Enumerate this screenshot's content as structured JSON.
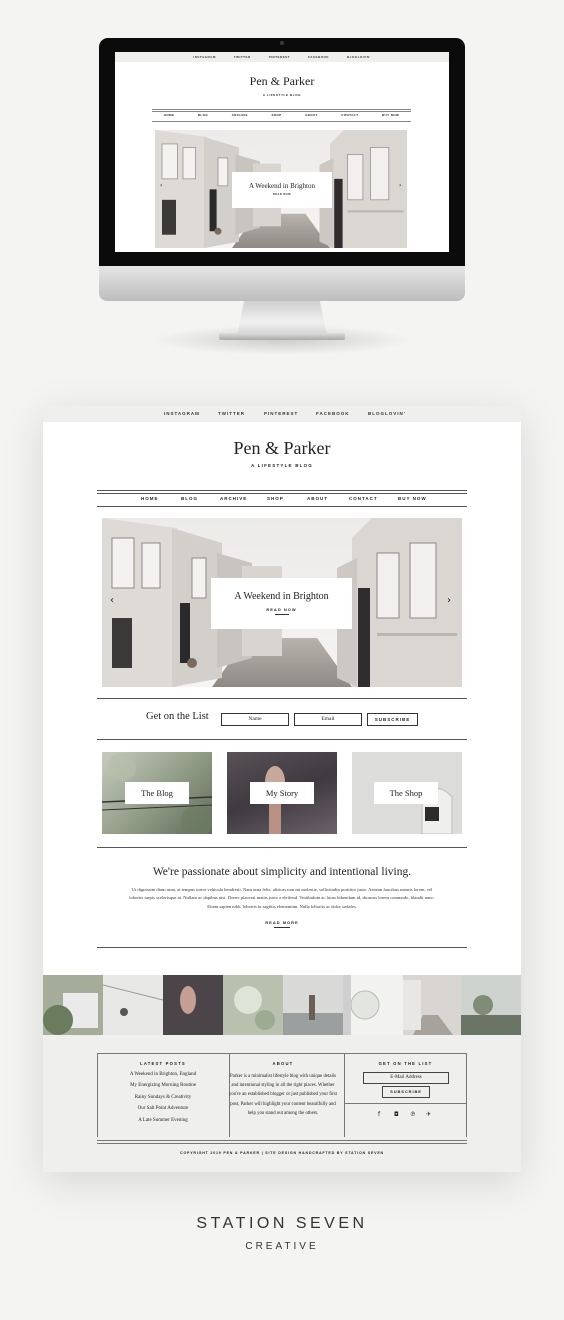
{
  "colors": {
    "background": "#f4f4f3",
    "topbar": "#efefee",
    "text": "#222222",
    "footer": "#efefee"
  },
  "social_links": [
    "INSTAGRAM",
    "TWITTER",
    "PINTEREST",
    "FACEBOOK",
    "BLOGLOVIN'"
  ],
  "site": {
    "title": "Pen & Parker",
    "tagline": "A LIFESTYLE BLOG"
  },
  "nav": [
    "HOME",
    "BLOG",
    "ARCHIVE",
    "SHOP",
    "ABOUT",
    "CONTACT",
    "BUY NOW"
  ],
  "hero": {
    "title": "A Weekend in Brighton",
    "cta": "READ NOW",
    "prev_icon": "chevron-left-icon",
    "next_icon": "chevron-right-icon"
  },
  "signup": {
    "label": "Get on the List",
    "name_placeholder": "Name",
    "email_placeholder": "Email",
    "button": "SUBSCRIBE"
  },
  "tiles": [
    "The Blog",
    "My Story",
    "The Shop"
  ],
  "intro": {
    "heading": "We're passionate about simplicity and intentional living.",
    "body": "Ut dignissim diam urna, at tempus tortor vehicula hendrerit. Nam urna felis, ultrices non mi molestie, sollicitudin porttitor justo. Aenean faucibus mauris lorem, vel lobortis turpis scelerisque at. Nullam ac dapibus nisi. Donec placerat mattis justo a eleifend. Vestibulum ac lacus bibendum id, rhoncus lorem commodo, blandit nunc. Etiam sapien nibh, lobortis in sagittis elementum. Nulla lobortis ac dolor sodales.",
    "cta": "READ MORE"
  },
  "footer": {
    "latest_heading": "LATEST POSTS",
    "latest_posts": [
      "A Weekend in Brighton, England",
      "My Energizing Morning Routine",
      "Rainy Sundays & Creativity",
      "Our Salt Point Adventure",
      "A Late Summer Evening"
    ],
    "about_heading": "ABOUT",
    "about_text": "Parker is a minimalist lifestyle blog with unique details and intentional styling in all the right places. Whether you're an established blogger or just published your first post, Parker will highlight your content beautifully and help you stand out among the others.",
    "list_heading": "GET ON THE LIST",
    "email_placeholder": "E-Mail Address",
    "subscribe": "SUBSCRIBE",
    "social_icons": [
      "facebook-icon",
      "instagram-icon",
      "pinterest-icon",
      "twitter-icon"
    ],
    "copyright": "COPYRIGHT 2019 PEN & PARKER | SITE DESIGN HANDCRAFTED BY STATION SEVEN"
  },
  "brand": {
    "line1": "STATION SEVEN",
    "line2": "CREATIVE"
  }
}
